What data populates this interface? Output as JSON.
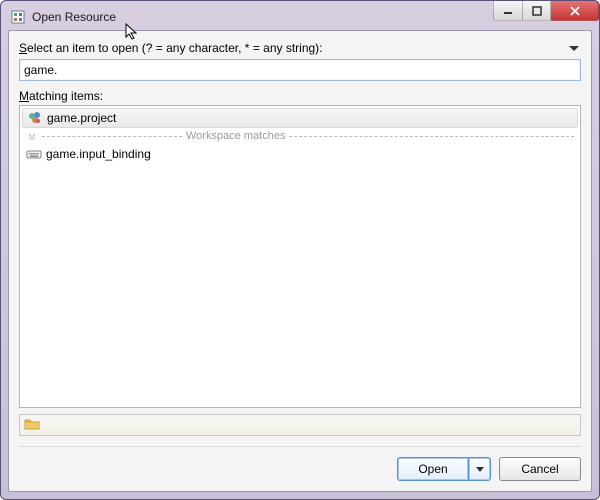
{
  "window": {
    "title": "Open Resource"
  },
  "prompt": {
    "prefix": "S",
    "mnemonic": "",
    "text": "elect an item to open (? = any character, * = any string):"
  },
  "filter": {
    "value": "game."
  },
  "matching": {
    "mnemonic": "M",
    "text": "atching items:"
  },
  "separator": {
    "label": "Workspace matches"
  },
  "items": {
    "selected": {
      "label": "game.project"
    },
    "other": [
      {
        "label": "game.input_binding"
      }
    ]
  },
  "status": {
    "path": ""
  },
  "buttons": {
    "open": "Open",
    "cancel": "Cancel"
  }
}
